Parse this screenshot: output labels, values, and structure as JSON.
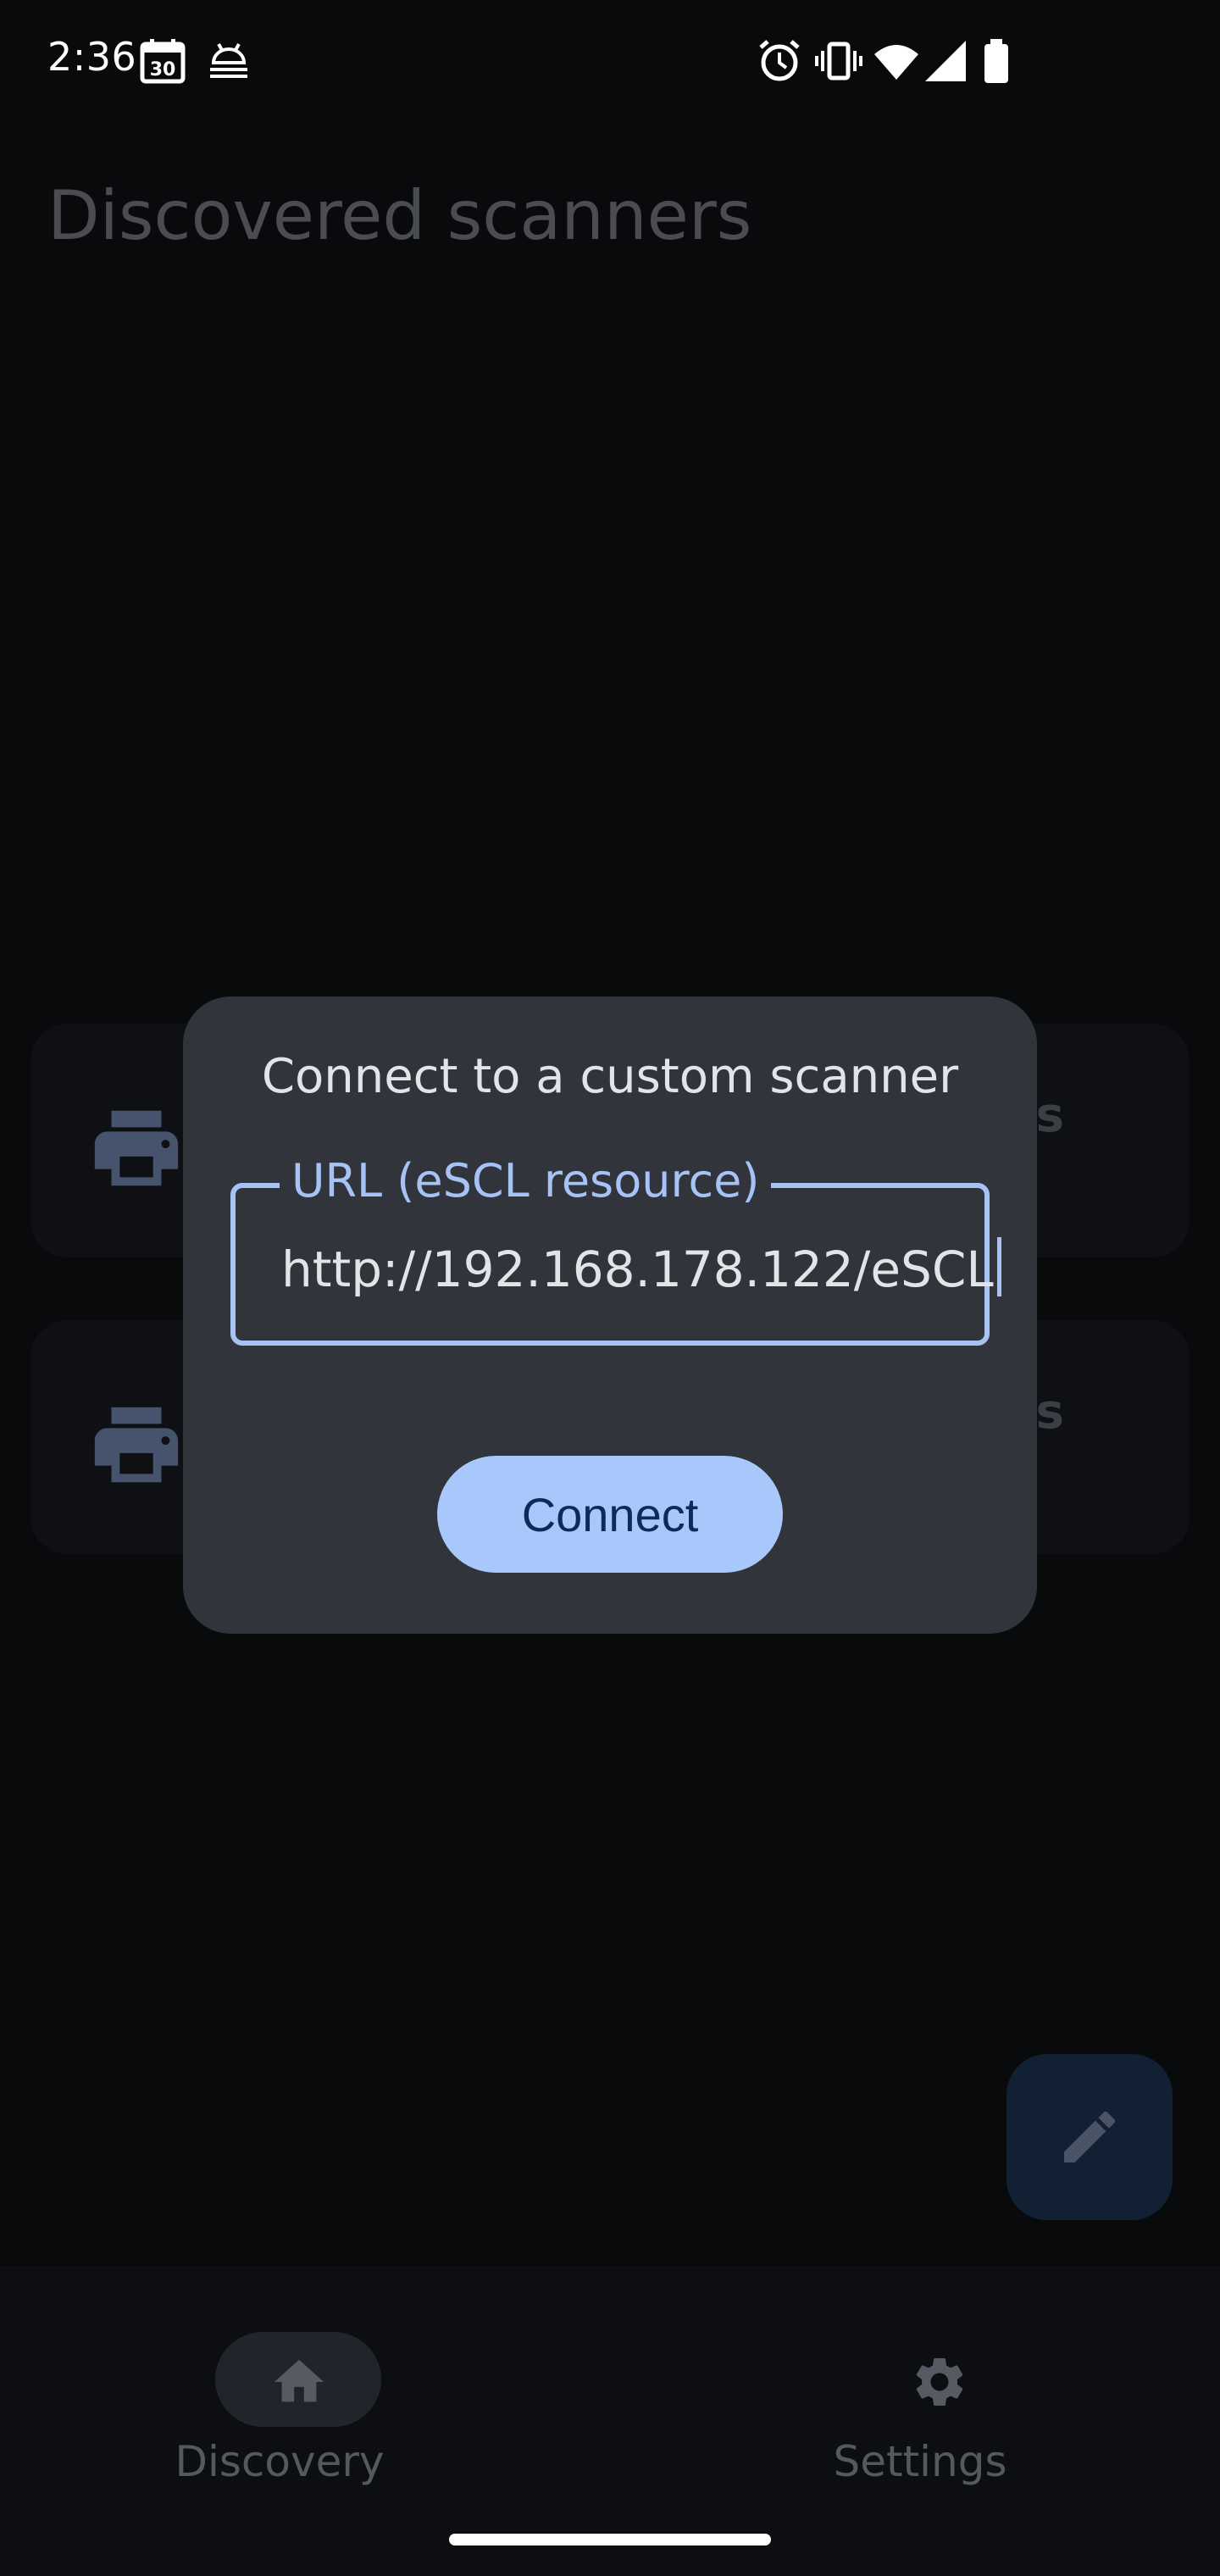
{
  "status_bar": {
    "time": "2:36",
    "calendar_day": "30",
    "icons": [
      "calendar-icon",
      "debug-icon",
      "alarm-icon",
      "vibrate-icon",
      "wifi-icon",
      "signal-icon",
      "battery-icon"
    ]
  },
  "page": {
    "title": "Discovered scanners"
  },
  "cards": [
    {
      "icon": "printer-icon",
      "trailing_text": "s"
    },
    {
      "icon": "printer-icon",
      "trailing_text": "s"
    }
  ],
  "dialog": {
    "title": "Connect to a custom scanner",
    "url_field": {
      "label": "URL (eSCL resource)",
      "value": "http://192.168.178.122/eSCL"
    },
    "connect_label": "Connect"
  },
  "fab": {
    "icon": "pencil-icon"
  },
  "bottom_nav": {
    "items": [
      {
        "label": "Discovery",
        "icon": "home-icon",
        "selected": true
      },
      {
        "label": "Settings",
        "icon": "gear-icon",
        "selected": false
      }
    ]
  },
  "colors": {
    "background": "#090a0c",
    "dialog_bg": "#31343b",
    "accent": "#a8c7fa",
    "field_outline": "#a7c2f5"
  }
}
